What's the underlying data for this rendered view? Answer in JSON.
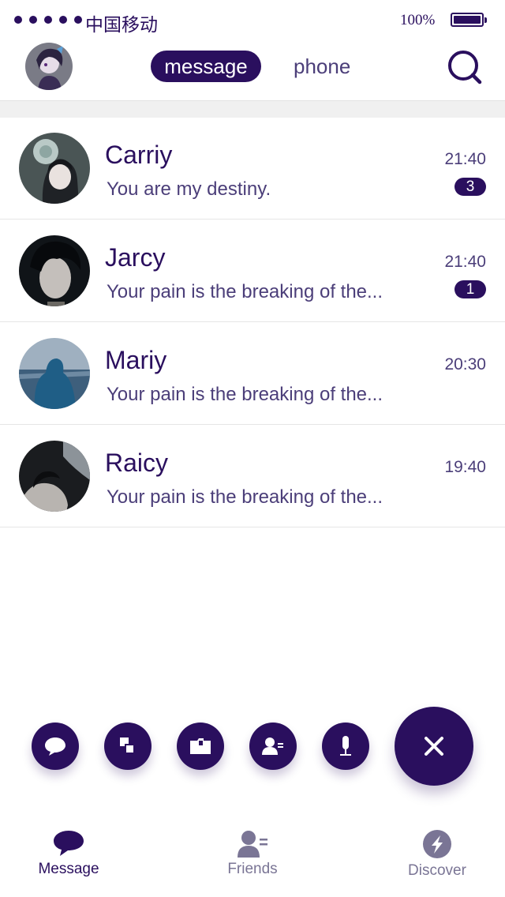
{
  "status_bar": {
    "carrier": "中国移动",
    "battery_percent": "100%"
  },
  "header": {
    "tabs": [
      {
        "label": "message",
        "active": true
      },
      {
        "label": "phone",
        "active": false
      }
    ],
    "search_icon": "search-icon"
  },
  "conversations": [
    {
      "name": "Carriy",
      "preview": "You are my destiny.",
      "time": "21:40",
      "unread": "3"
    },
    {
      "name": "Jarcy",
      "preview": "Your pain is the breaking of the...",
      "time": "21:40",
      "unread": "1"
    },
    {
      "name": "Mariy",
      "preview": "Your pain is the breaking of the...",
      "time": "20:30",
      "unread": null
    },
    {
      "name": "Raicy",
      "preview": "Your pain is the breaking of the...",
      "time": "19:40",
      "unread": null
    }
  ],
  "actions": [
    {
      "icon": "chat-bubble-icon"
    },
    {
      "icon": "copy-icon"
    },
    {
      "icon": "folder-icon"
    },
    {
      "icon": "add-contact-icon"
    },
    {
      "icon": "microphone-icon"
    },
    {
      "icon": "close-icon"
    }
  ],
  "bottom_nav": [
    {
      "label": "Message",
      "icon": "message-icon",
      "active": true
    },
    {
      "label": "Friends",
      "icon": "friends-icon",
      "active": false
    },
    {
      "label": "Discover",
      "icon": "discover-icon",
      "active": false
    }
  ],
  "colors": {
    "primary": "#2a0f5e",
    "text_secondary": "#4b3e79",
    "nav_inactive": "#7a7595",
    "divider": "#e6e6e6"
  }
}
